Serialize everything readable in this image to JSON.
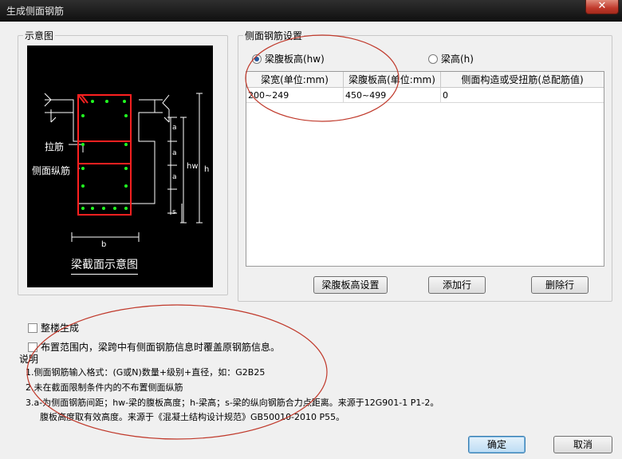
{
  "window": {
    "title": "生成侧面钢筋",
    "close_label": "✕"
  },
  "diagram_group": {
    "label": "示意图",
    "labels": {
      "tie_bar": "拉筋",
      "side_bar": "侧面纵筋",
      "caption": "梁截面示意图",
      "dim_a": "a",
      "dim_s": "s",
      "dim_hw": "hw",
      "dim_h": "h",
      "dim_b": "b"
    }
  },
  "settings_group": {
    "label": "侧面钢筋设置",
    "radio_web_height": "梁腹板高(hw)",
    "radio_beam_height": "梁高(h)",
    "selected": "web_height",
    "table": {
      "columns": [
        "梁宽(单位:mm)",
        "梁腹板高(单位:mm)",
        "侧面构造或受扭筋(总配筋值)"
      ],
      "rows": [
        [
          "200~249",
          "450~499",
          "0"
        ]
      ]
    },
    "buttons": {
      "web_height_setting": "梁腹板高设置",
      "add_row": "添加行",
      "delete_row": "删除行"
    }
  },
  "options": {
    "whole_building": "整楼生成",
    "overwrite": "布置范围内，梁跨中有侧面钢筋信息时覆盖原钢筋信息。"
  },
  "notes": {
    "title": "说明",
    "line1": "1.侧面钢筋输入格式：(G或N)数量+级别+直径，如：G2B25",
    "line2": "2.未在截面限制条件内的不布置侧面纵筋",
    "line3": "3.a-为侧面钢筋间距；hw-梁的腹板高度；h-梁高；s-梁的纵向钢筋合力点距离。来源于12G901-1 P1-2。",
    "line4": "腹板高度取有效高度。来源于《混凝土结构设计规范》GB50010-2010 P55。"
  },
  "footer": {
    "ok": "确定",
    "cancel": "取消"
  },
  "colors": {
    "annotation": "#c0392b",
    "rebar": "#ff2020",
    "dot": "#20ff20"
  }
}
